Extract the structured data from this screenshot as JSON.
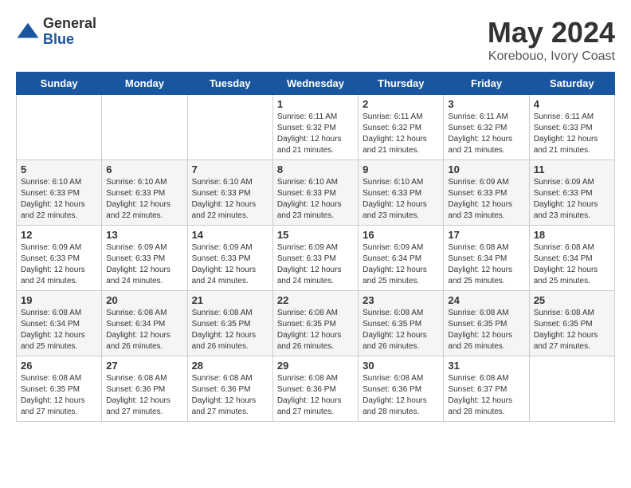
{
  "logo": {
    "general": "General",
    "blue": "Blue"
  },
  "title": "May 2024",
  "subtitle": "Korebouo, Ivory Coast",
  "days_of_week": [
    "Sunday",
    "Monday",
    "Tuesday",
    "Wednesday",
    "Thursday",
    "Friday",
    "Saturday"
  ],
  "weeks": [
    [
      {
        "day": "",
        "info": ""
      },
      {
        "day": "",
        "info": ""
      },
      {
        "day": "",
        "info": ""
      },
      {
        "day": "1",
        "info": "Sunrise: 6:11 AM\nSunset: 6:32 PM\nDaylight: 12 hours\nand 21 minutes."
      },
      {
        "day": "2",
        "info": "Sunrise: 6:11 AM\nSunset: 6:32 PM\nDaylight: 12 hours\nand 21 minutes."
      },
      {
        "day": "3",
        "info": "Sunrise: 6:11 AM\nSunset: 6:32 PM\nDaylight: 12 hours\nand 21 minutes."
      },
      {
        "day": "4",
        "info": "Sunrise: 6:11 AM\nSunset: 6:33 PM\nDaylight: 12 hours\nand 21 minutes."
      }
    ],
    [
      {
        "day": "5",
        "info": "Sunrise: 6:10 AM\nSunset: 6:33 PM\nDaylight: 12 hours\nand 22 minutes."
      },
      {
        "day": "6",
        "info": "Sunrise: 6:10 AM\nSunset: 6:33 PM\nDaylight: 12 hours\nand 22 minutes."
      },
      {
        "day": "7",
        "info": "Sunrise: 6:10 AM\nSunset: 6:33 PM\nDaylight: 12 hours\nand 22 minutes."
      },
      {
        "day": "8",
        "info": "Sunrise: 6:10 AM\nSunset: 6:33 PM\nDaylight: 12 hours\nand 23 minutes."
      },
      {
        "day": "9",
        "info": "Sunrise: 6:10 AM\nSunset: 6:33 PM\nDaylight: 12 hours\nand 23 minutes."
      },
      {
        "day": "10",
        "info": "Sunrise: 6:09 AM\nSunset: 6:33 PM\nDaylight: 12 hours\nand 23 minutes."
      },
      {
        "day": "11",
        "info": "Sunrise: 6:09 AM\nSunset: 6:33 PM\nDaylight: 12 hours\nand 23 minutes."
      }
    ],
    [
      {
        "day": "12",
        "info": "Sunrise: 6:09 AM\nSunset: 6:33 PM\nDaylight: 12 hours\nand 24 minutes."
      },
      {
        "day": "13",
        "info": "Sunrise: 6:09 AM\nSunset: 6:33 PM\nDaylight: 12 hours\nand 24 minutes."
      },
      {
        "day": "14",
        "info": "Sunrise: 6:09 AM\nSunset: 6:33 PM\nDaylight: 12 hours\nand 24 minutes."
      },
      {
        "day": "15",
        "info": "Sunrise: 6:09 AM\nSunset: 6:33 PM\nDaylight: 12 hours\nand 24 minutes."
      },
      {
        "day": "16",
        "info": "Sunrise: 6:09 AM\nSunset: 6:34 PM\nDaylight: 12 hours\nand 25 minutes."
      },
      {
        "day": "17",
        "info": "Sunrise: 6:08 AM\nSunset: 6:34 PM\nDaylight: 12 hours\nand 25 minutes."
      },
      {
        "day": "18",
        "info": "Sunrise: 6:08 AM\nSunset: 6:34 PM\nDaylight: 12 hours\nand 25 minutes."
      }
    ],
    [
      {
        "day": "19",
        "info": "Sunrise: 6:08 AM\nSunset: 6:34 PM\nDaylight: 12 hours\nand 25 minutes."
      },
      {
        "day": "20",
        "info": "Sunrise: 6:08 AM\nSunset: 6:34 PM\nDaylight: 12 hours\nand 26 minutes."
      },
      {
        "day": "21",
        "info": "Sunrise: 6:08 AM\nSunset: 6:35 PM\nDaylight: 12 hours\nand 26 minutes."
      },
      {
        "day": "22",
        "info": "Sunrise: 6:08 AM\nSunset: 6:35 PM\nDaylight: 12 hours\nand 26 minutes."
      },
      {
        "day": "23",
        "info": "Sunrise: 6:08 AM\nSunset: 6:35 PM\nDaylight: 12 hours\nand 26 minutes."
      },
      {
        "day": "24",
        "info": "Sunrise: 6:08 AM\nSunset: 6:35 PM\nDaylight: 12 hours\nand 26 minutes."
      },
      {
        "day": "25",
        "info": "Sunrise: 6:08 AM\nSunset: 6:35 PM\nDaylight: 12 hours\nand 27 minutes."
      }
    ],
    [
      {
        "day": "26",
        "info": "Sunrise: 6:08 AM\nSunset: 6:35 PM\nDaylight: 12 hours\nand 27 minutes."
      },
      {
        "day": "27",
        "info": "Sunrise: 6:08 AM\nSunset: 6:36 PM\nDaylight: 12 hours\nand 27 minutes."
      },
      {
        "day": "28",
        "info": "Sunrise: 6:08 AM\nSunset: 6:36 PM\nDaylight: 12 hours\nand 27 minutes."
      },
      {
        "day": "29",
        "info": "Sunrise: 6:08 AM\nSunset: 6:36 PM\nDaylight: 12 hours\nand 27 minutes."
      },
      {
        "day": "30",
        "info": "Sunrise: 6:08 AM\nSunset: 6:36 PM\nDaylight: 12 hours\nand 28 minutes."
      },
      {
        "day": "31",
        "info": "Sunrise: 6:08 AM\nSunset: 6:37 PM\nDaylight: 12 hours\nand 28 minutes."
      },
      {
        "day": "",
        "info": ""
      }
    ]
  ]
}
